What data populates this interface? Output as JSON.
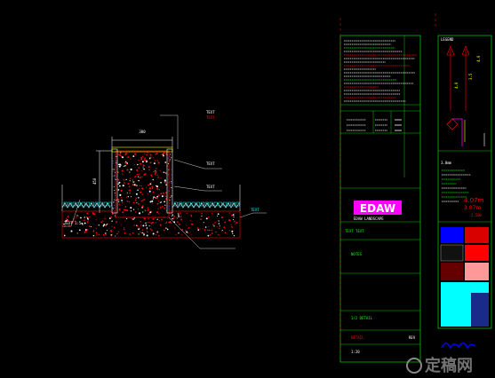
{
  "drawing": {
    "dimension_top": "300",
    "dimension_side": "450",
    "section_labels": {
      "left_top": "TEXT 1:5",
      "right_top_1": "TEXT",
      "right_top_2": "TEXT",
      "right_mid_1": "TEXT",
      "right_mid_2": "TEXT",
      "right_low": "TEXT"
    }
  },
  "title_block": {
    "logo": "EDAW",
    "logo_caption": "EDAW LANDSCAPE",
    "project_line": "TEXT TEXT",
    "sheet_title": "1/2 DETAIL",
    "drawing_no": "DETAIL",
    "notes_heading": "NOTES",
    "rev_label": "REV",
    "scale_label": "1:20"
  },
  "legend_panel": {
    "top_header": "LEGEND",
    "level_values": [
      "4.0",
      "3.5",
      "4.0"
    ],
    "section_header": "3.0mm",
    "big_value_1": "4.07m",
    "big_value_2": "3.07m",
    "big_value_3": "2.50m"
  },
  "watermark": {
    "text": "定稿网"
  },
  "colors": {
    "background": "#000000",
    "green": "#00ff00",
    "red": "#ff0000",
    "white": "#ffffff",
    "cyan": "#00ffff",
    "magenta": "#ff00ff",
    "yellow": "#ffff00",
    "blue": "#0000ff"
  }
}
